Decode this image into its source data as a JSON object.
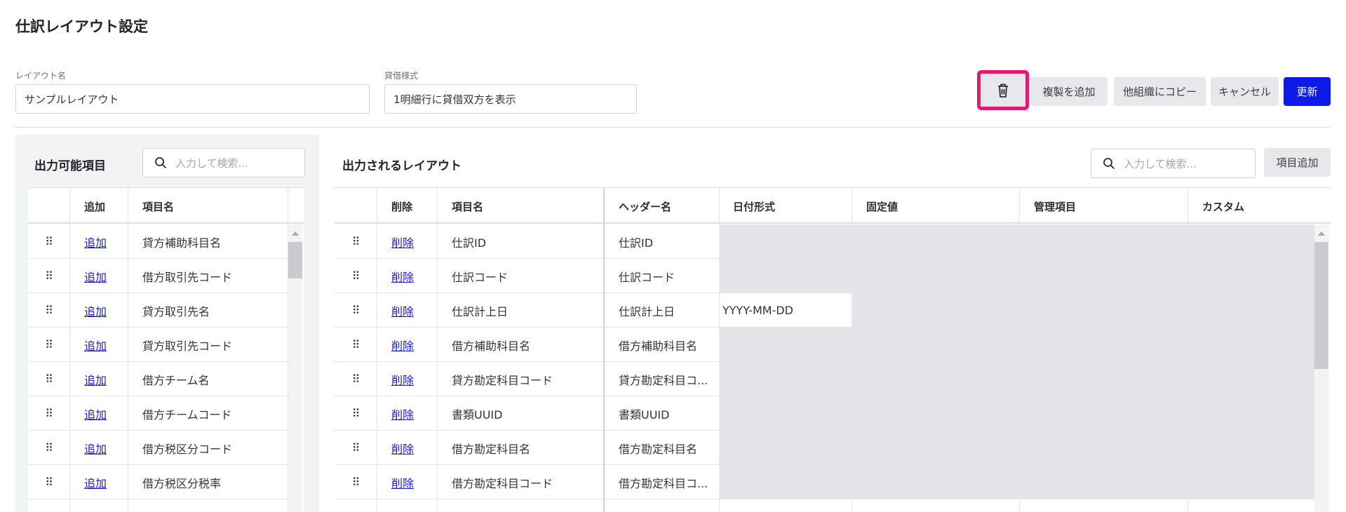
{
  "page": {
    "title": "仕訳レイアウト設定"
  },
  "form": {
    "layout_name_label": "レイアウト名",
    "layout_name_value": "サンプルレイアウト",
    "debit_credit_label": "貸借様式",
    "debit_credit_value": "1明細行に貸借双方を表示"
  },
  "actions": {
    "delete_icon": "trash-icon",
    "duplicate_label": "複製を追加",
    "copy_org_label": "他組織にコピー",
    "cancel_label": "キャンセル",
    "update_label": "更新"
  },
  "left_panel": {
    "title": "出力可能項目",
    "search_placeholder": "入力して検索...",
    "columns": [
      "追加",
      "項目名"
    ],
    "rows": [
      {
        "action": "追加",
        "name": "貸方補助科目名"
      },
      {
        "action": "追加",
        "name": "借方取引先コード"
      },
      {
        "action": "追加",
        "name": "貸方取引先名"
      },
      {
        "action": "追加",
        "name": "貸方取引先コード"
      },
      {
        "action": "追加",
        "name": "借方チーム名"
      },
      {
        "action": "追加",
        "name": "借方チームコード"
      },
      {
        "action": "追加",
        "name": "借方税区分コード"
      },
      {
        "action": "追加",
        "name": "借方税区分税率"
      }
    ]
  },
  "right_panel": {
    "title": "出力されるレイアウト",
    "search_placeholder": "入力して検索...",
    "add_item_label": "項目追加",
    "columns": [
      "削除",
      "項目名",
      "ヘッダー名",
      "日付形式",
      "固定値",
      "管理項目",
      "カスタム"
    ],
    "rows": [
      {
        "action": "削除",
        "name": "仕訳ID",
        "header": "仕訳ID",
        "date_format": ""
      },
      {
        "action": "削除",
        "name": "仕訳コード",
        "header": "仕訳コード",
        "date_format": ""
      },
      {
        "action": "削除",
        "name": "仕訳計上日",
        "header": "仕訳計上日",
        "date_format": "YYYY-MM-DD"
      },
      {
        "action": "削除",
        "name": "借方補助科目名",
        "header": "借方補助科目名",
        "date_format": ""
      },
      {
        "action": "削除",
        "name": "貸方勘定科目コード",
        "header": "貸方勘定科目コ...",
        "date_format": ""
      },
      {
        "action": "削除",
        "name": "書類UUID",
        "header": "書類UUID",
        "date_format": ""
      },
      {
        "action": "削除",
        "name": "借方勘定科目名",
        "header": "借方勘定科目名",
        "date_format": ""
      },
      {
        "action": "削除",
        "name": "借方勘定科目コード",
        "header": "借方勘定科目コ...",
        "date_format": ""
      }
    ]
  },
  "grip_glyph": "⠿"
}
